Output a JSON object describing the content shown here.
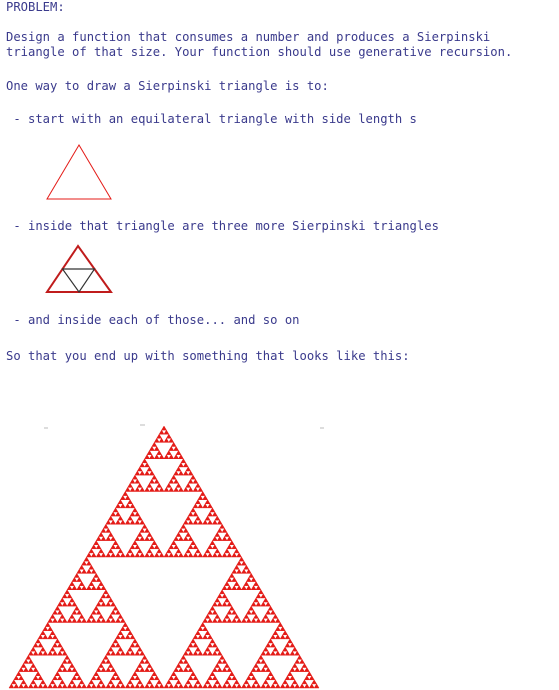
{
  "heading": "PROBLEM:",
  "problem_lines": [
    "Design a function that consumes a number and produces a Sierpinski",
    "triangle of that size. Your function should use generative recursion."
  ],
  "intro": "One way to draw a Sierpinski triangle is to:",
  "step1": " - start with an equilateral triangle with side length s",
  "step2": " - inside that triangle are three more Sierpinski triangles",
  "step3": " - and inside each of those... and so on",
  "conclusion": "So that you end up with something that looks like this:",
  "colors": {
    "text": "#3a3a8c",
    "triangle": "#e41b17",
    "inner": "#333333"
  },
  "fractal_depth": 6
}
